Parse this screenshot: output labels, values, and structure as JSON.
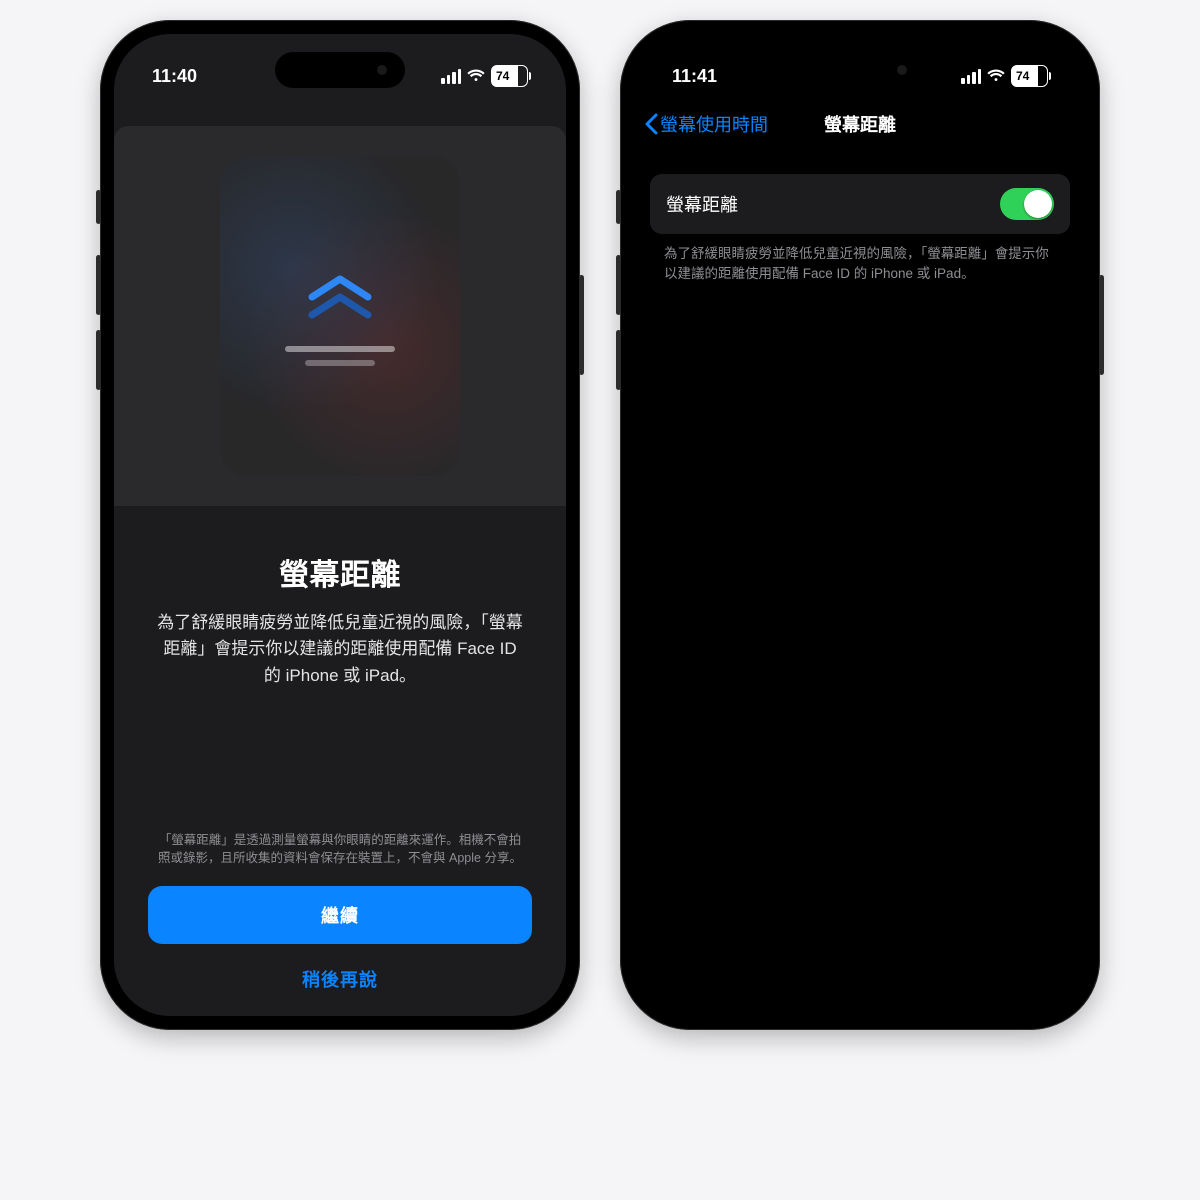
{
  "left": {
    "time": "11:40",
    "battery": "74",
    "hero_icon": "distance-chevrons-icon",
    "title": "螢幕距離",
    "description": "為了舒緩眼睛疲勞並降低兒童近視的風險，「螢幕距離」會提示你以建議的距離使用配備 Face ID 的 iPhone 或 iPad。",
    "footnote": "「螢幕距離」是透過測量螢幕與你眼睛的距離來運作。相機不會拍照或錄影，且所收集的資料會保存在裝置上，不會與 Apple 分享。",
    "primary": "繼續",
    "secondary": "稍後再說"
  },
  "right": {
    "time": "11:41",
    "battery": "74",
    "back_label": "螢幕使用時間",
    "nav_title": "螢幕距離",
    "toggle_label": "螢幕距離",
    "toggle_on": true,
    "footer": "為了舒緩眼睛疲勞並降低兒童近視的風險，「螢幕距離」會提示你以建議的距離使用配備 Face ID 的 iPhone 或 iPad。"
  },
  "colors": {
    "accent": "#0a84ff",
    "toggle_on": "#30d158"
  }
}
